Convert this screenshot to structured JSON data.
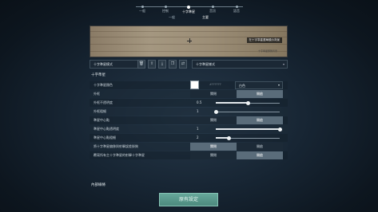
{
  "nav": {
    "items": [
      {
        "label": "一般",
        "active": false
      },
      {
        "label": "控制",
        "active": false
      },
      {
        "label": "十字準星",
        "active": true
      },
      {
        "label": "音訊",
        "active": false
      },
      {
        "label": "語音",
        "active": false
      }
    ],
    "subtabs": [
      {
        "label": "一般",
        "active": false
      },
      {
        "label": "主要",
        "active": true
      }
    ]
  },
  "preview": {
    "tag": "在十字準星選單顯示背景",
    "sub": "十字準星預覽背景"
  },
  "profile": {
    "select_value": "十字準星模式",
    "second_select_value": "十字準星樣式",
    "icons": [
      "trash-icon",
      "upload-icon",
      "download-icon",
      "copy-icon",
      "swap-icon"
    ]
  },
  "crosshair": {
    "section_title": "十字準星",
    "color_label": "十字準星顏色",
    "color_hex": "#FFFFFF",
    "color_dropdown": "白色",
    "swatch_color": "#ffffff",
    "outline_label": "外框",
    "outline_options": [
      "關閉",
      "開啟"
    ],
    "outline_selected": 1,
    "outline_opacity_label": "外框不透明度",
    "outline_opacity_value": "0.5",
    "outline_opacity_fraction": 0.5,
    "outline_thickness_label": "外框粗細",
    "outline_thickness_value": "1",
    "outline_thickness_fraction": 0.0,
    "center_dot_label": "準星中心點",
    "center_dot_options": [
      "關閉",
      "開啟"
    ],
    "center_dot_selected": 1,
    "center_dot_opacity_label": "準星中心點透明度",
    "center_dot_opacity_value": "1",
    "center_dot_opacity_fraction": 1.0,
    "center_dot_thickness_label": "準星中心點粗細",
    "center_dot_thickness_value": "2",
    "center_dot_thickness_fraction": 0.2,
    "override_firing_error_label": "將十字準星偏移與射擊誤差掛鉤",
    "override_firing_error_options": [
      "關閉",
      "開啟"
    ],
    "override_firing_error_selected": 0,
    "override_all_label": "覆寫所有主十字準星的射擊十字準星",
    "override_all_options": [
      "關閉",
      "開啟"
    ],
    "override_all_selected": 1
  },
  "inner_lines": {
    "section_title": "內部線條"
  },
  "footer": {
    "reset_label": "原有設定"
  }
}
